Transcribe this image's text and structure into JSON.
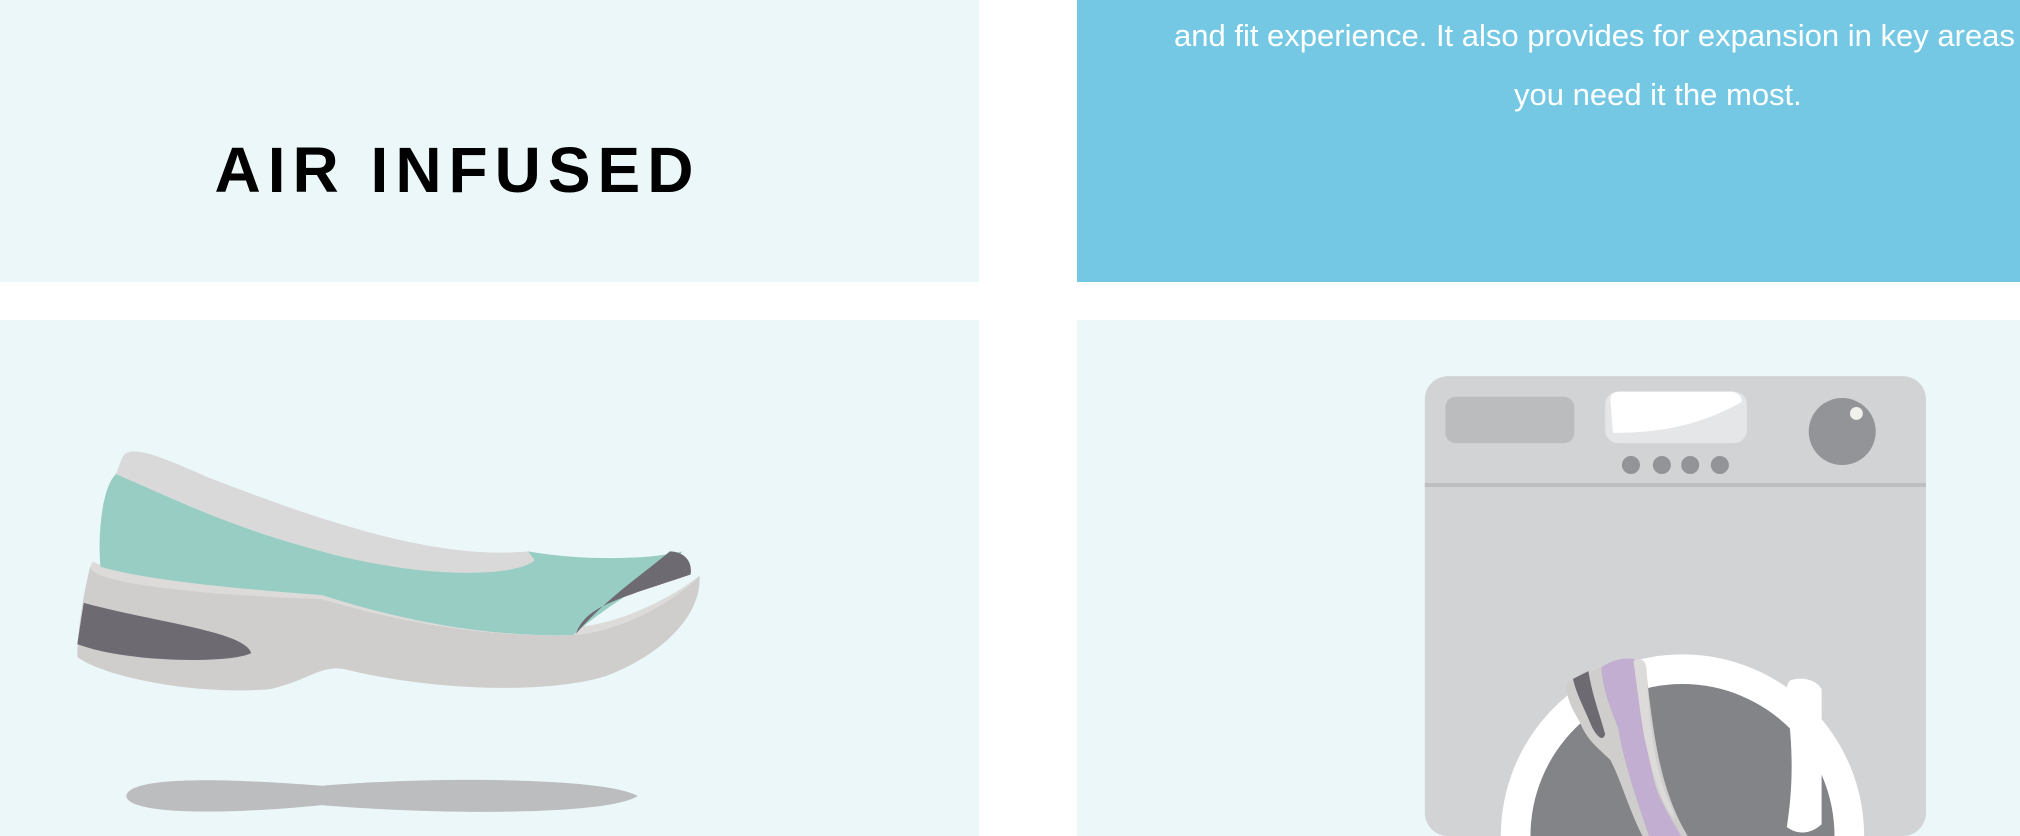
{
  "feature": {
    "title": "AIR INFUSED",
    "description_lines": [
      "and fit experience. It also provides for expansion in key areas",
      "you need it the most."
    ]
  },
  "colors": {
    "panel_light": "#ebf7f9",
    "panel_accent": "#74c8e4",
    "shoe_teal": "#97cdc2",
    "shoe_purple": "#c2aed0",
    "washer_gray": "#d2d3d5"
  },
  "illustrations": {
    "left": "floating-shoe-illustration",
    "right": "washing-machine-illustration"
  }
}
